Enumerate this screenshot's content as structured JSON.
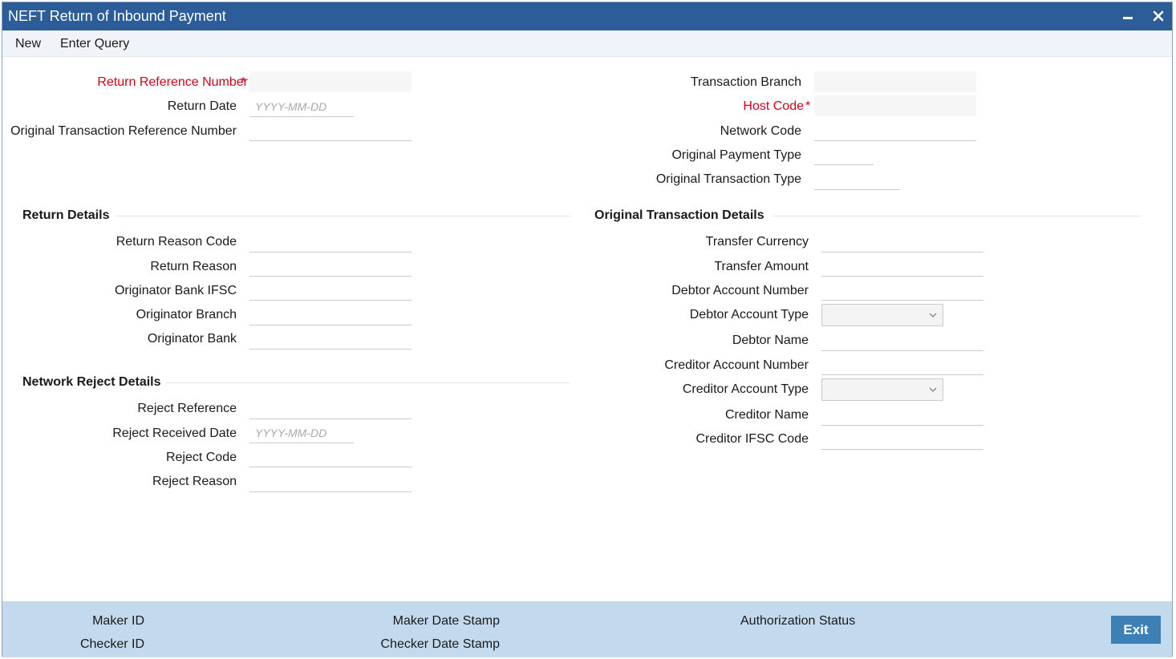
{
  "window": {
    "title": "NEFT Return of Inbound Payment",
    "minimize_icon": "minimize-icon",
    "close_icon": "close-icon"
  },
  "menu": {
    "new_label": "New",
    "enter_query_label": "Enter Query"
  },
  "header_left": {
    "return_reference_number": "Return Reference Number",
    "return_date": "Return Date",
    "return_date_placeholder": "YYYY-MM-DD",
    "original_transaction_reference_number": "Original Transaction Reference Number"
  },
  "header_right": {
    "transaction_branch": "Transaction Branch",
    "host_code": "Host Code",
    "network_code": "Network Code",
    "original_payment_type": "Original Payment Type",
    "original_transaction_type": "Original Transaction Type"
  },
  "required_marker": "*",
  "return_details": {
    "heading": "Return Details",
    "return_reason_code": "Return Reason Code",
    "return_reason": "Return Reason",
    "originator_bank_ifsc": "Originator Bank IFSC",
    "originator_branch": "Originator Branch",
    "originator_bank": "Originator Bank"
  },
  "network_reject_details": {
    "heading": "Network Reject Details",
    "reject_reference": "Reject Reference",
    "reject_received_date": "Reject Received Date",
    "reject_received_date_placeholder": "YYYY-MM-DD",
    "reject_code": "Reject Code",
    "reject_reason": "Reject Reason"
  },
  "original_transaction_details": {
    "heading": "Original Transaction Details",
    "transfer_currency": "Transfer Currency",
    "transfer_amount": "Transfer Amount",
    "debtor_account_number": "Debtor Account Number",
    "debtor_account_type": "Debtor Account Type",
    "debtor_name": "Debtor Name",
    "creditor_account_number": "Creditor Account Number",
    "creditor_account_type": "Creditor Account Type",
    "creditor_name": "Creditor Name",
    "creditor_ifsc_code": "Creditor IFSC Code"
  },
  "footer": {
    "maker_id": "Maker ID",
    "checker_id": "Checker ID",
    "maker_date_stamp": "Maker Date Stamp",
    "checker_date_stamp": "Checker Date Stamp",
    "authorization_status": "Authorization Status",
    "exit_label": "Exit"
  },
  "colors": {
    "titlebar": "#2c5d98",
    "footer": "#c3d9ee",
    "exit_button": "#3c80b5",
    "required": "#d0021b"
  }
}
